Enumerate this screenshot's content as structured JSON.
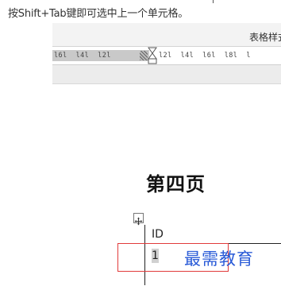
{
  "caption": "按Shift+Tab键即可选中上一个单元格。",
  "ribbon": {
    "tab_label": "表格样式"
  },
  "ruler": {
    "left_numbers": "l6l  l4l  l2l",
    "right_numbers": "l2l  l4l  l6l  l8l  l"
  },
  "document": {
    "heading": "第四页",
    "table": {
      "header_cell": "ID",
      "row_cell": "1"
    }
  },
  "watermark": "最需教育",
  "colors": {
    "highlight_box": "#e13b3b",
    "watermark": "#2a5bd7",
    "cell_selection": "#d0d0d0"
  },
  "icons": {
    "table_move_handle": "move-cross-icon",
    "indent_marker": "indent-marker-icon"
  }
}
